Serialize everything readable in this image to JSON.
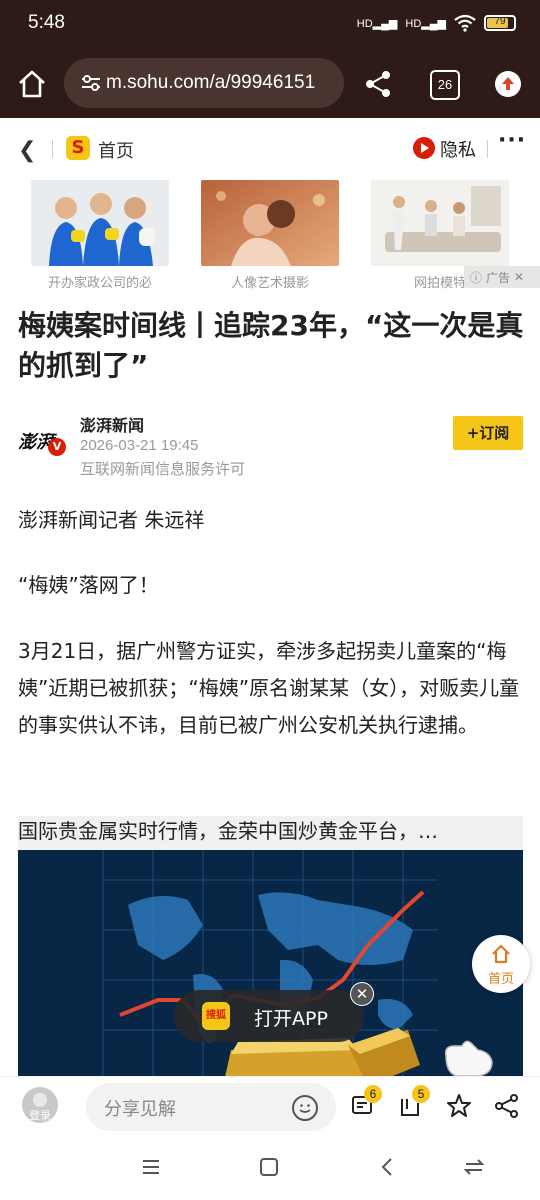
{
  "status_bar": {
    "time": "5:48",
    "signal1": "HD",
    "signal2": "HD",
    "battery": "79"
  },
  "browser": {
    "url": "m.sohu.com/a/99946151",
    "tab_count": "26"
  },
  "nav": {
    "home_label": "首页",
    "privacy_label": "隐私",
    "logo_letter": "S"
  },
  "ads": {
    "items": [
      {
        "caption": "开办家政公司的必"
      },
      {
        "caption": "人像艺术摄影"
      },
      {
        "caption": "网拍模特"
      }
    ],
    "badge_label": "广告"
  },
  "article": {
    "title": "梅姨案时间线丨追踪23年，“这一次是真的抓到了”",
    "author": {
      "name": "澎湃新闻",
      "date": "2026-03-21 19:45",
      "license": "互联网新闻信息服务许可",
      "avatar_text": "澎湃",
      "verified": "V"
    },
    "subscribe_label": "+订阅",
    "paragraphs": [
      "澎湃新闻记者 朱远祥",
      "“梅姨”落网了！",
      "3月21日，据广州警方证实，牵涉多起拐卖儿童案的“梅姨”近期已被抓获；“梅姨”原名谢某某（女），对贩卖儿童的事实供认不讳，目前已被广州公安机关执行逮捕。"
    ],
    "inline_ad_title": "国际贵金属实时行情，金荣中国炒黄金平台，…"
  },
  "floating": {
    "home_label": "首页",
    "open_app_label": "打开APP",
    "app_icon_text": "搜狐",
    "close_symbol": "✕"
  },
  "toolbar": {
    "login_label": "登录",
    "comment_placeholder": "分享见解",
    "comment_count": "6",
    "collect_count": "5"
  },
  "colors": {
    "brand_yellow": "#f5c518",
    "brand_red": "#d81e06",
    "browser_bar": "#2e1a16"
  }
}
